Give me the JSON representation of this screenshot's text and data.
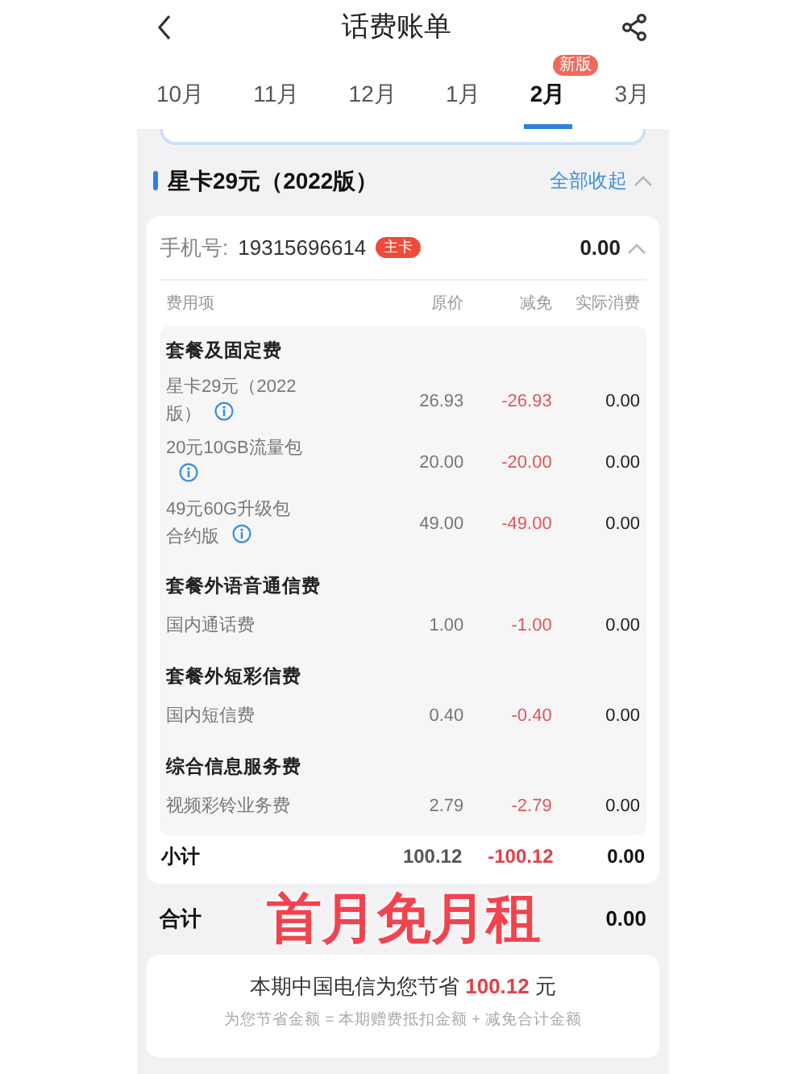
{
  "header": {
    "title": "话费账单"
  },
  "tabs": [
    {
      "label": "10月",
      "selected": false
    },
    {
      "label": "11月",
      "selected": false
    },
    {
      "label": "12月",
      "selected": false
    },
    {
      "label": "1月",
      "selected": false
    },
    {
      "label": "2月",
      "selected": true,
      "badge": "新版"
    },
    {
      "label": "3月",
      "selected": false
    }
  ],
  "plan": {
    "title": "星卡29元（2022版）",
    "collapse_link": "全部收起",
    "expanded": true
  },
  "phone": {
    "label": "手机号:",
    "number": "19315696614",
    "tag": "主卡",
    "amount": "0.00",
    "expanded": true
  },
  "table": {
    "columns": [
      "费用项",
      "原价",
      "减免",
      "实际消费"
    ],
    "groups": [
      {
        "title": "套餐及固定费",
        "rows": [
          {
            "name": "星卡29元（2022版）",
            "info": true,
            "price": "26.93",
            "discount": "-26.93",
            "actual": "0.00"
          },
          {
            "name": "20元10GB流量包",
            "info": true,
            "price": "20.00",
            "discount": "-20.00",
            "actual": "0.00"
          },
          {
            "name": "49元60G升级包合约版",
            "info": true,
            "price": "49.00",
            "discount": "-49.00",
            "actual": "0.00"
          }
        ]
      },
      {
        "title": "套餐外语音通信费",
        "rows": [
          {
            "name": "国内通话费",
            "info": false,
            "price": "1.00",
            "discount": "-1.00",
            "actual": "0.00"
          }
        ]
      },
      {
        "title": "套餐外短彩信费",
        "rows": [
          {
            "name": "国内短信费",
            "info": false,
            "price": "0.40",
            "discount": "-0.40",
            "actual": "0.00"
          }
        ]
      },
      {
        "title": "综合信息服务费",
        "rows": [
          {
            "name": "视频彩铃业务费",
            "info": false,
            "price": "2.79",
            "discount": "-2.79",
            "actual": "0.00"
          }
        ]
      }
    ],
    "subtotal": {
      "label": "小计",
      "price": "100.12",
      "discount": "-100.12",
      "actual": "0.00"
    }
  },
  "total": {
    "label": "合计",
    "overlay": "首月免月租",
    "amount": "0.00"
  },
  "savings": {
    "prefix": "本期中国电信为您节省",
    "amount": "100.12",
    "suffix": "元",
    "note": "为您节省金额 = 本期赠费抵扣金额 + 减免合计金额"
  }
}
